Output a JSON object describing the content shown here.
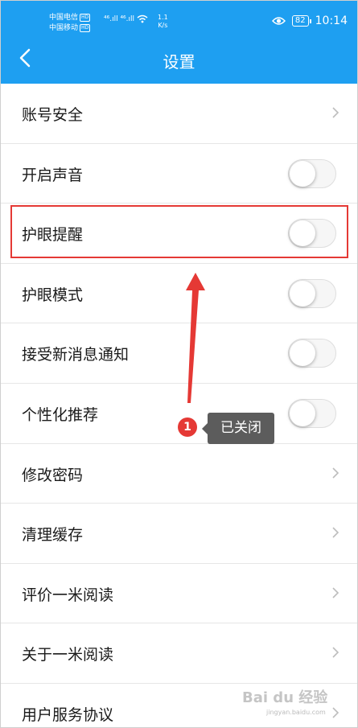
{
  "status_bar": {
    "carrier_1": "中国电信",
    "carrier_2": "中国移动",
    "hd_badge": "HD",
    "signal_1": "⁴⁶.ıll",
    "signal_2": "⁴⁶.ıll",
    "speed_value": "1.1",
    "speed_unit": "K/s",
    "battery": "82",
    "time": "10:14",
    "icons": [
      "eye-icon",
      "wifi-icon",
      "battery-icon"
    ]
  },
  "header": {
    "title": "设置",
    "back_icon": "chevron-left-icon"
  },
  "settings": [
    {
      "label": "账号安全",
      "control": "chevron"
    },
    {
      "label": "开启声音",
      "control": "toggle",
      "on": false
    },
    {
      "label": "护眼提醒",
      "control": "toggle",
      "on": false
    },
    {
      "label": "护眼模式",
      "control": "toggle",
      "on": false
    },
    {
      "label": "接受新消息通知",
      "control": "toggle",
      "on": false
    },
    {
      "label": "个性化推荐",
      "control": "toggle",
      "on": false
    },
    {
      "label": "修改密码",
      "control": "chevron"
    },
    {
      "label": "清理缓存",
      "control": "chevron"
    },
    {
      "label": "评价一米阅读",
      "control": "chevron"
    },
    {
      "label": "关于一米阅读",
      "control": "chevron"
    },
    {
      "label": "用户服务协议",
      "control": "chevron"
    }
  ],
  "annotation": {
    "step_number": "1",
    "tooltip": "已关闭",
    "highlight_color": "#e53935",
    "arrow_color": "#e53935"
  },
  "watermark": {
    "text": "Bai du 经验",
    "sub": "jingyan.baidu.com"
  },
  "colors": {
    "header_bg": "#1e9ff1",
    "text": "#1a1a1a",
    "divider": "#e6e6e6"
  }
}
